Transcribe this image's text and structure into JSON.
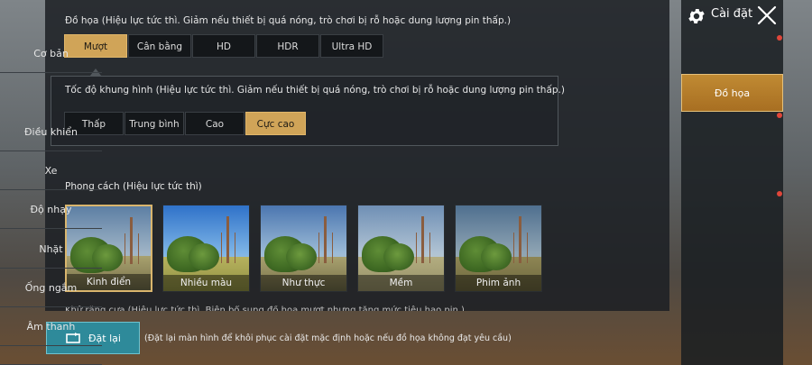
{
  "graphics": {
    "title": "Đồ họa (Hiệu lực tức thì. Giảm nếu thiết bị quá nóng, trò chơi bị rỗ hoặc dung lượng pin thấp.)",
    "options": [
      "Mượt",
      "Cân bằng",
      "HD",
      "HDR",
      "Ultra HD"
    ],
    "selected": "Mượt"
  },
  "framerate": {
    "title": "Tốc độ khung hình (Hiệu lực tức thì. Giảm nếu thiết bị quá nóng, trò chơi bị rỗ hoặc dung lượng pin thấp.)",
    "options": [
      "Thấp",
      "Trung bình",
      "Cao",
      "Cực cao"
    ],
    "selected": "Cực cao"
  },
  "style": {
    "title": "Phong cách (Hiệu lực tức thì)",
    "items": [
      "Kinh điển",
      "Nhiều màu",
      "Như thực",
      "Mềm",
      "Phim ảnh"
    ],
    "selected": "Kinh điển"
  },
  "cut_text": "Khử răng cưa (Hiệu lực tức thì. Biên bổ sung đồ họa mượt nhưng tăng mức tiêu hao pin.)",
  "reset": {
    "label": "Đặt lại",
    "note": "(Đặt lại màn hình để khôi phục cài đặt mặc định hoặc nếu đồ họa không đạt yêu cầu)"
  },
  "header": {
    "title": "Cài đặt",
    "settings_icon": "gear-icon",
    "close_icon": "close-icon"
  },
  "sidebar": {
    "items": [
      "Cơ bản",
      "Đồ họa",
      "Điều khiển",
      "Xe",
      "Độ nhạy",
      "Nhặt",
      "Ống ngắm",
      "Âm thanh"
    ],
    "active": "Đồ họa"
  },
  "colors": {
    "accent": "#d0a458",
    "sidebar_active": "#b57a28",
    "reset_button": "#2e8a9a",
    "notice_dot": "#e0463a"
  }
}
